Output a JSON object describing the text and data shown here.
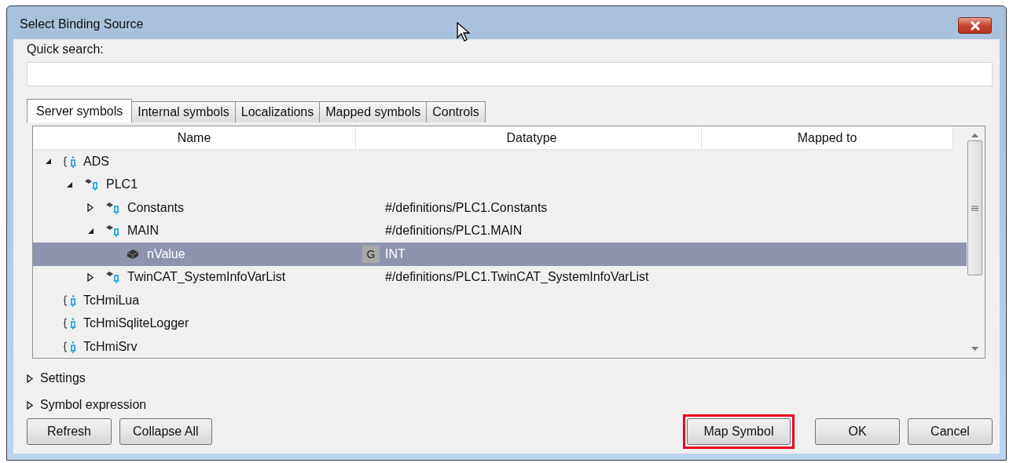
{
  "window": {
    "title": "Select Binding Source"
  },
  "quick_search": {
    "label": "Quick search:"
  },
  "tabs": [
    {
      "label": "Server symbols",
      "selected": true
    },
    {
      "label": "Internal symbols",
      "selected": false
    },
    {
      "label": "Localizations",
      "selected": false
    },
    {
      "label": "Mapped symbols",
      "selected": false
    },
    {
      "label": "Controls",
      "selected": false
    }
  ],
  "table": {
    "columns": [
      "Name",
      "Datatype",
      "Mapped to"
    ],
    "rows": [
      {
        "name": "ADS",
        "kind": "server",
        "expanded": true,
        "selected": false,
        "children": [
          {
            "name": "PLC1",
            "kind": "namespace",
            "expanded": true,
            "selected": false,
            "children": [
              {
                "name": "Constants",
                "kind": "namespace",
                "expanded": false,
                "selected": false,
                "datatype": "#/definitions/PLC1.Constants"
              },
              {
                "name": "MAIN",
                "kind": "namespace",
                "expanded": true,
                "selected": false,
                "datatype": "#/definitions/PLC1.MAIN",
                "children": [
                  {
                    "name": "nValue",
                    "kind": "symbol",
                    "selected": true,
                    "badge": "G",
                    "datatype": "INT"
                  }
                ]
              },
              {
                "name": "TwinCAT_SystemInfoVarList",
                "kind": "namespace",
                "expanded": false,
                "selected": false,
                "datatype": "#/definitions/PLC1.TwinCAT_SystemInfoVarList"
              }
            ]
          }
        ]
      },
      {
        "name": "TcHmiLua",
        "kind": "server",
        "selected": false
      },
      {
        "name": "TcHmiSqliteLogger",
        "kind": "server",
        "selected": false
      },
      {
        "name": "TcHmiSrv",
        "kind": "server",
        "selected": false
      }
    ]
  },
  "sections": [
    {
      "label": "Settings",
      "expanded": false
    },
    {
      "label": "Symbol expression",
      "expanded": false
    }
  ],
  "buttons_left": [
    {
      "label": "Refresh",
      "highlighted": false
    },
    {
      "label": "Collapse All",
      "highlighted": false
    }
  ],
  "buttons_right": [
    {
      "label": "Map Symbol",
      "highlighted": true
    },
    {
      "label": "OK",
      "highlighted": false
    },
    {
      "label": "Cancel",
      "highlighted": false
    }
  ]
}
